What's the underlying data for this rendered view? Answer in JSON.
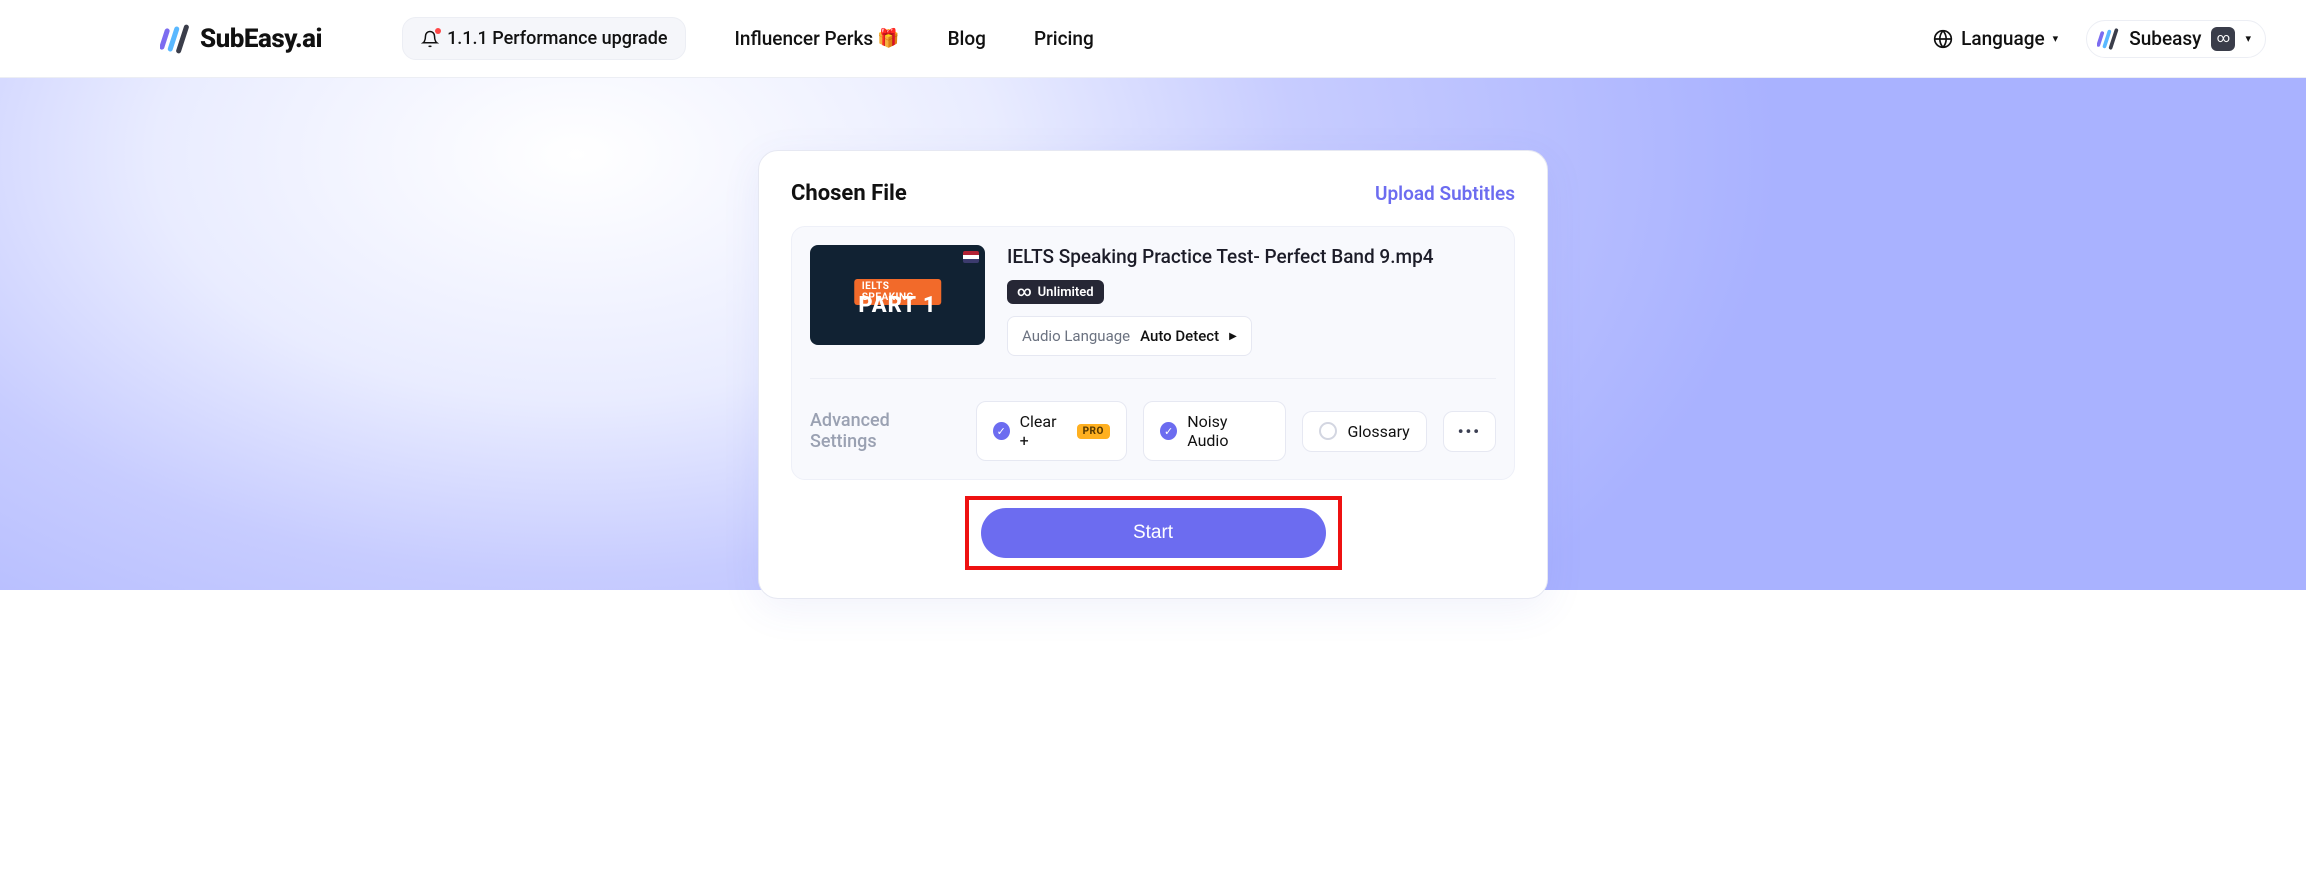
{
  "header": {
    "logo_text": "SubEasy.ai",
    "announce": "1.1.1 Performance upgrade",
    "nav": {
      "influencer": "Influencer Perks",
      "blog": "Blog",
      "pricing": "Pricing"
    },
    "language_label": "Language",
    "account_name": "Subeasy"
  },
  "card": {
    "title": "Chosen File",
    "upload_link": "Upload Subtitles",
    "thumb": {
      "tag": "IELTS SPEAKING",
      "big": "PART 1"
    },
    "file_name": "IELTS Speaking Practice Test- Perfect Band 9.mp4",
    "unlimited_label": "Unlimited",
    "audio_lang_label": "Audio Language",
    "audio_lang_value": "Auto Detect",
    "adv_label": "Advanced Settings",
    "chips": {
      "clear": "Clear +",
      "pro": "PRO",
      "noisy": "Noisy Audio",
      "glossary": "Glossary"
    },
    "start": "Start"
  }
}
